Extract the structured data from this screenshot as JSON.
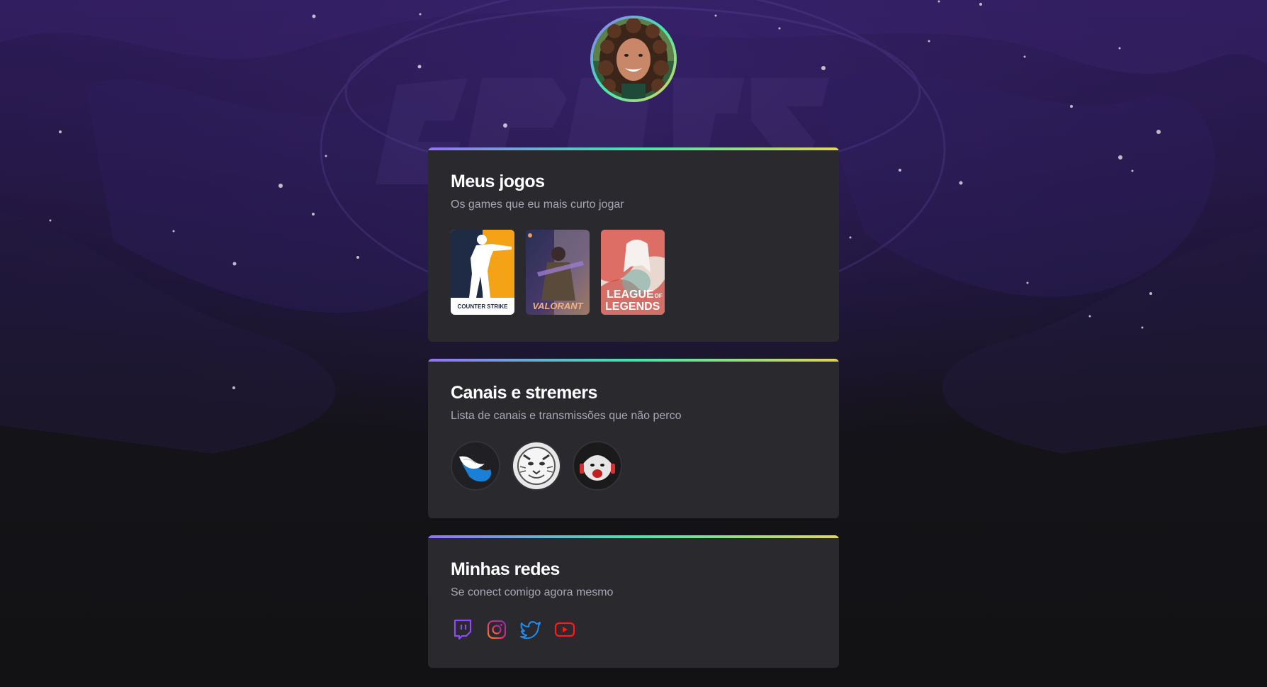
{
  "profile": {
    "avatar_icon": "profile-photo"
  },
  "games_card": {
    "title": "Meus jogos",
    "subtitle": "Os games que eu mais curto jogar",
    "games": [
      {
        "name": "Counter-Strike",
        "logo_text_1": "COUNTER",
        "logo_text_2": "STRIKE"
      },
      {
        "name": "Valorant",
        "logo_text": "VALORANT"
      },
      {
        "name": "League of Legends",
        "logo_text_1": "LEAGUE",
        "logo_text_of": "OF",
        "logo_text_2": "LEGENDS"
      }
    ]
  },
  "channels_card": {
    "title": "Canais e stremers",
    "subtitle": "Lista de canais e transmissões que não perco",
    "channels": [
      {
        "icon": "winged-logo-icon"
      },
      {
        "icon": "tiger-logo-icon"
      },
      {
        "icon": "streamer-face-icon"
      }
    ]
  },
  "socials_card": {
    "title": "Minhas redes",
    "subtitle": "Se conect comigo agora mesmo",
    "links": [
      {
        "icon": "twitch-icon",
        "color": "#9146ff"
      },
      {
        "icon": "instagram-icon",
        "color": "#e1306c"
      },
      {
        "icon": "twitter-icon",
        "color": "#1da1f2"
      },
      {
        "icon": "youtube-icon",
        "color": "#ff0000"
      }
    ]
  },
  "colors": {
    "accent_start": "#9572fc",
    "accent_mid": "#43e7ad",
    "accent_end": "#e2d45c",
    "card_bg": "#29292e"
  }
}
